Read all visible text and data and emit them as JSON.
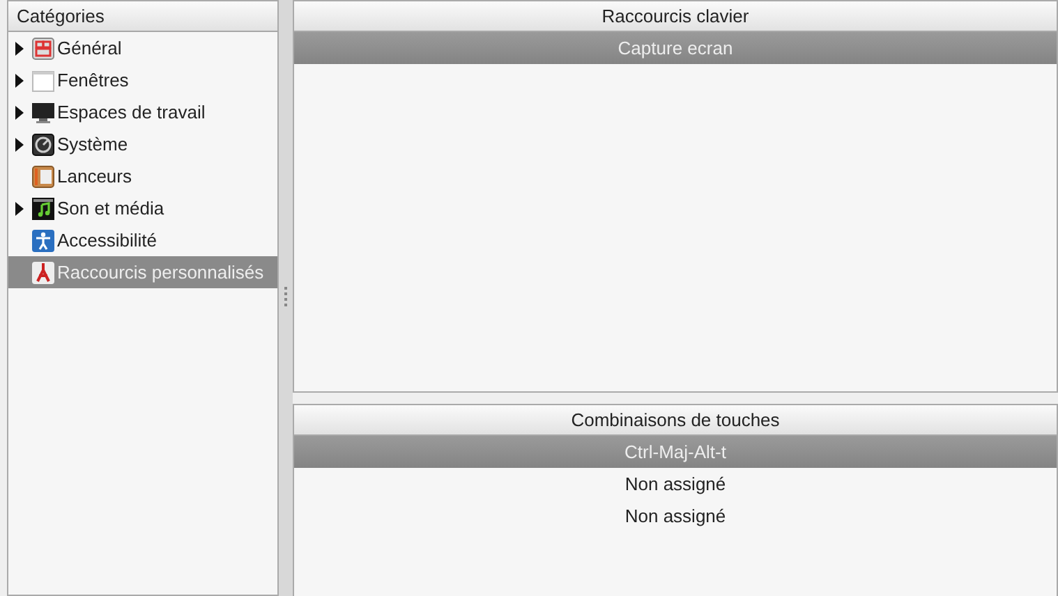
{
  "categories": {
    "title": "Catégories",
    "items": [
      {
        "label": "Général",
        "kind": "general",
        "expandable": true,
        "selected": false
      },
      {
        "label": "Fenêtres",
        "kind": "windows",
        "expandable": true,
        "selected": false
      },
      {
        "label": "Espaces de travail",
        "kind": "workspaces",
        "expandable": true,
        "selected": false
      },
      {
        "label": "Système",
        "kind": "system",
        "expandable": true,
        "selected": false
      },
      {
        "label": "Lanceurs",
        "kind": "launchers",
        "expandable": false,
        "selected": false
      },
      {
        "label": "Son et média",
        "kind": "media",
        "expandable": true,
        "selected": false
      },
      {
        "label": "Accessibilité",
        "kind": "accessibility",
        "expandable": false,
        "selected": false
      },
      {
        "label": "Raccourcis personnalisés",
        "kind": "custom",
        "expandable": false,
        "selected": true
      }
    ]
  },
  "shortcuts": {
    "title": "Raccourcis clavier",
    "rows": [
      {
        "label": "Capture ecran",
        "selected": true
      }
    ]
  },
  "bindings": {
    "title": "Combinaisons de touches",
    "rows": [
      {
        "label": "Ctrl-Maj-Alt-t",
        "selected": true
      },
      {
        "label": "Non assigné",
        "selected": false
      },
      {
        "label": "Non assigné",
        "selected": false
      }
    ]
  }
}
